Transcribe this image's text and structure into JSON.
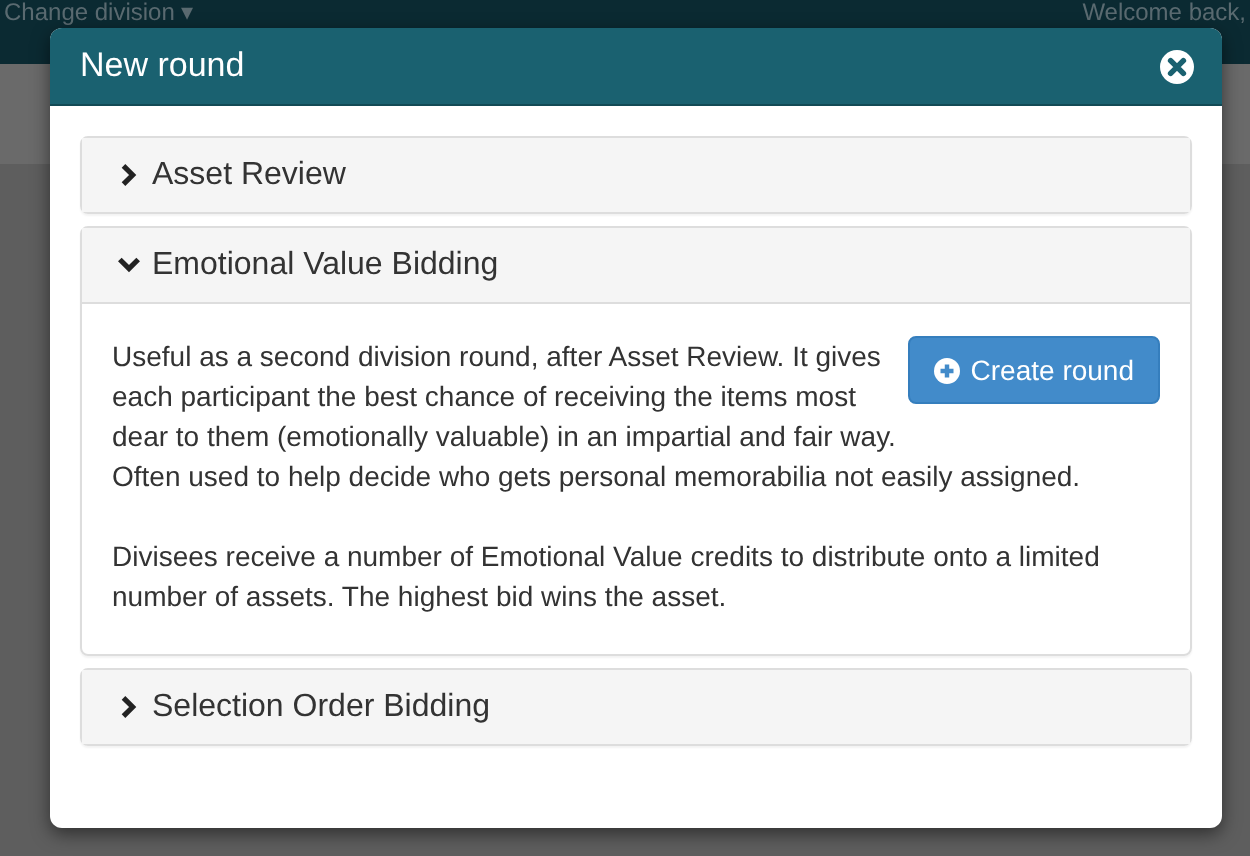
{
  "background": {
    "menu": "Change division",
    "caret": "▾",
    "greeting": "Welcome back,"
  },
  "modal": {
    "title": "New round"
  },
  "panels": [
    {
      "title": "Asset Review",
      "expanded": false
    },
    {
      "title": "Emotional Value Bidding",
      "expanded": true,
      "paragraphs": [
        "Useful as a second division round, after Asset Review. It gives each participant the best chance of receiving the items most dear to them (emotionally valuable) in an impartial and fair way.",
        "Often used to help decide who gets personal memorabilia not easily assigned.",
        "Divisees receive a number of Emotional Value credits to distribute onto a limited number of assets. The highest bid wins the asset."
      ],
      "button": "Create round"
    },
    {
      "title": "Selection Order Bidding",
      "expanded": false
    }
  ]
}
